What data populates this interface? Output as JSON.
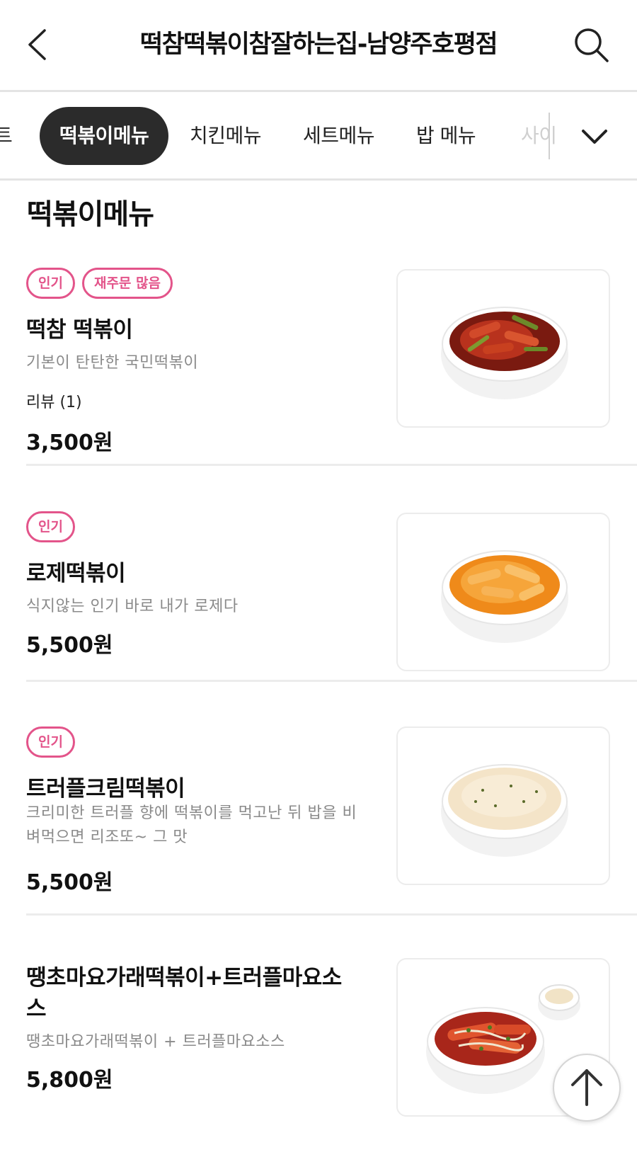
{
  "header": {
    "title": "떡참떡볶이참잘하는집-남양주호평점"
  },
  "tabs": {
    "items": [
      {
        "label": "트"
      },
      {
        "label": "떡볶이메뉴",
        "active": true
      },
      {
        "label": "치킨메뉴"
      },
      {
        "label": "세트메뉴"
      },
      {
        "label": "밥 메뉴"
      },
      {
        "label": "사이"
      }
    ]
  },
  "section": {
    "title": "떡볶이메뉴"
  },
  "menu_items": [
    {
      "badges": [
        "인기",
        "재주문 많음"
      ],
      "name": "떡참 떡볶이",
      "description": "기본이 탄탄한 국민떡볶이",
      "review": "리뷰 (1)",
      "price": "3,500원"
    },
    {
      "badges": [
        "인기"
      ],
      "name": "로제떡볶이",
      "description": "식지않는 인기 바로 내가 로제다",
      "price": "5,500원"
    },
    {
      "badges": [
        "인기"
      ],
      "name": "트러플크림떡볶이",
      "description": "크리미한 트러플 향에 떡볶이를 먹고난 뒤 밥을 비벼먹으면 리조또~ 그 맛",
      "price": "5,500원"
    },
    {
      "name_line1": "땡초마요가래떡볶이+트러플마요소",
      "name_line2": "스",
      "description": "땡초마요가래떡볶이 + 트러플마요소스",
      "price": "5,800원"
    }
  ],
  "colors": {
    "badge": "#e3548a",
    "active_tab_bg": "#2b2b2b",
    "divider": "#ececec"
  }
}
